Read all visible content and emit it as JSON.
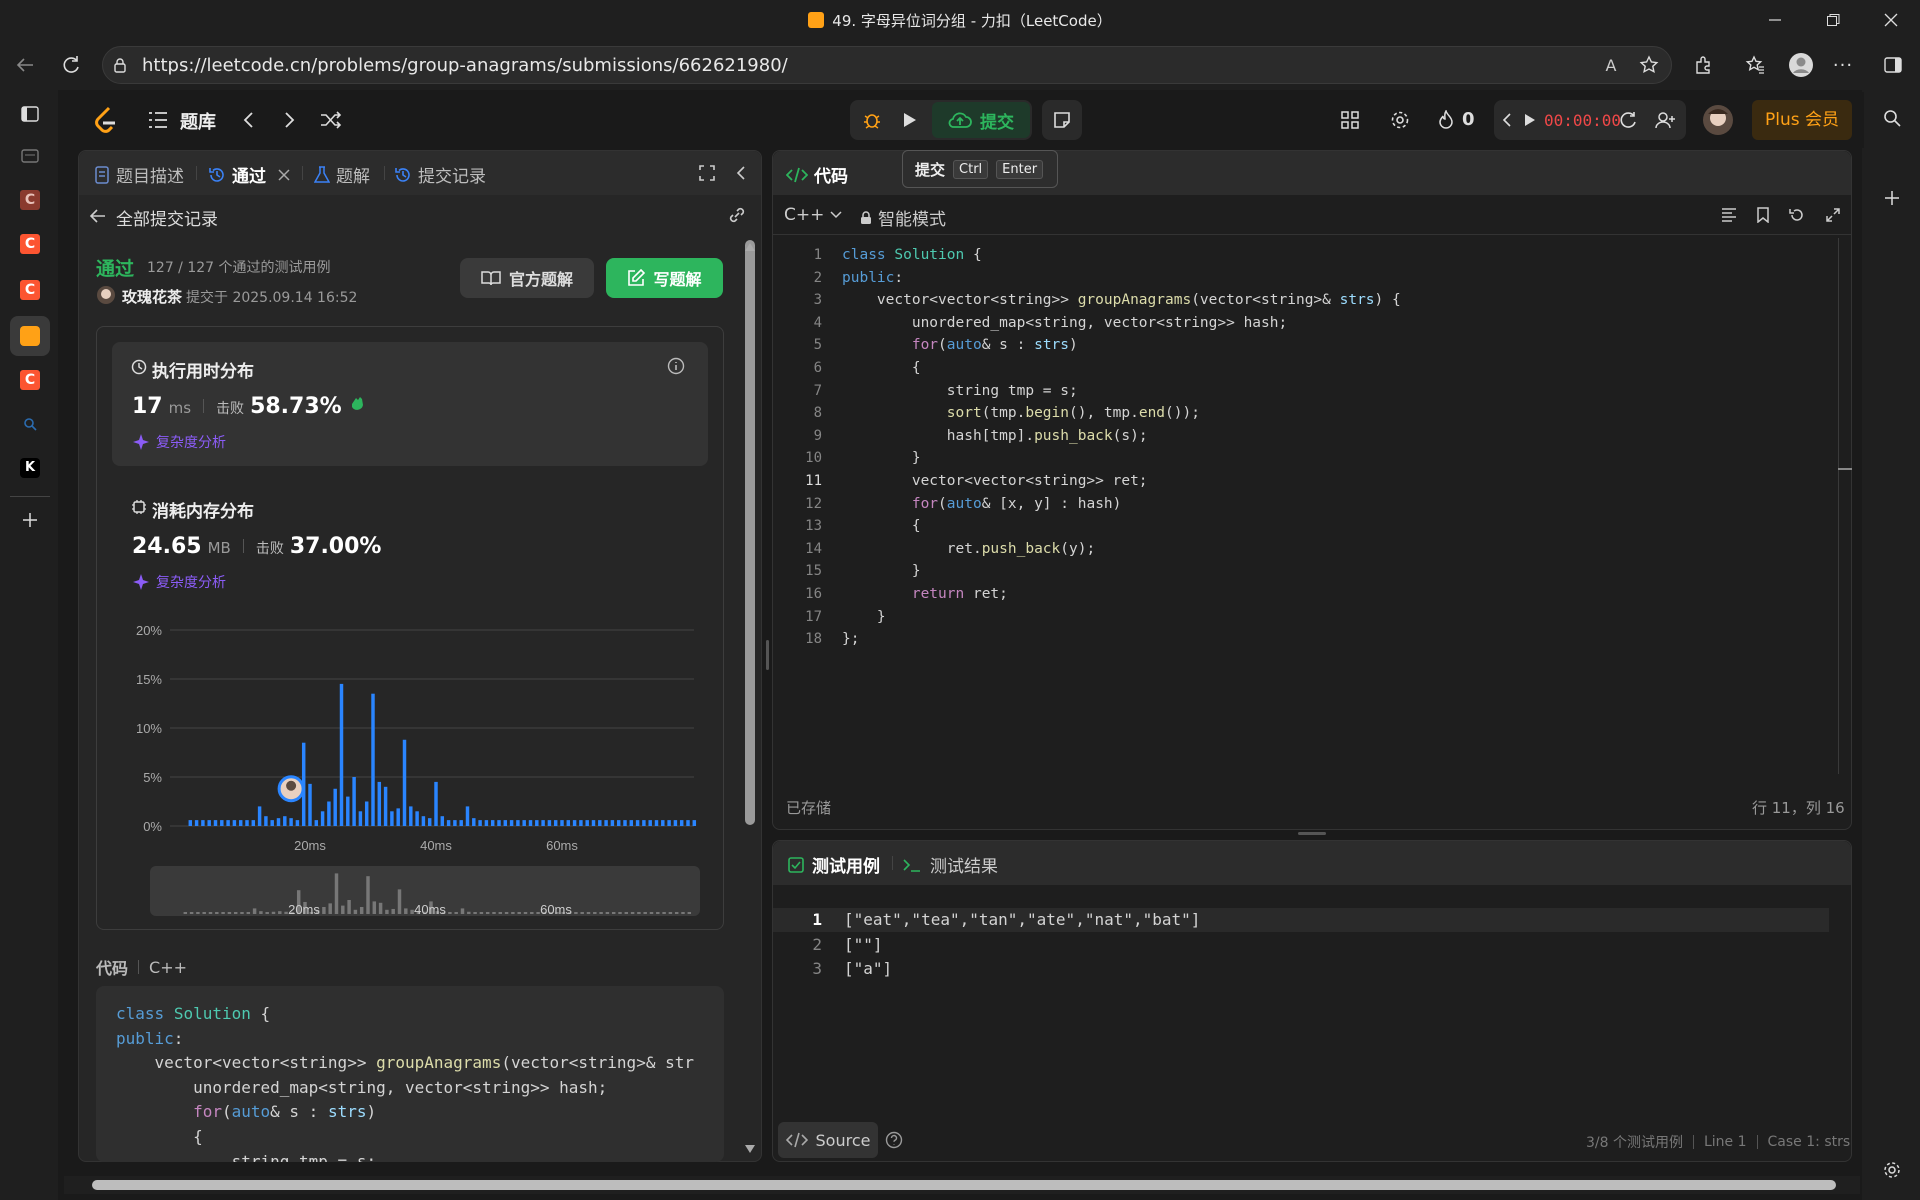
{
  "browser": {
    "title": "49. 字母异位词分组 - 力扣（LeetCode）",
    "url": "https://leetcode.cn/problems/group-anagrams/submissions/662621980/"
  },
  "nav": {
    "problem_bank": "题库",
    "submit": "提交",
    "streak": "0",
    "timer": "00:00:00",
    "plus": "Plus 会员",
    "tooltip": {
      "label": "提交",
      "key1": "Ctrl",
      "key2": "Enter"
    }
  },
  "left": {
    "tabs": [
      "题目描述",
      "通过",
      "题解",
      "提交记录"
    ],
    "back": "全部提交记录",
    "status": "通过",
    "testcases": "127 / 127 个通过的测试用例",
    "user": "玫瑰花茶",
    "submitted": "提交于 2025.09.14 16:52",
    "btn_official": "官方题解",
    "btn_write": "写题解",
    "runtime": {
      "title": "执行用时分布",
      "value": "17",
      "unit": "ms",
      "beat_label": "击败",
      "beat": "58.73%",
      "analysis": "复杂度分析"
    },
    "memory": {
      "title": "消耗内存分布",
      "value": "24.65",
      "unit": "MB",
      "beat_label": "击败",
      "beat": "37.00%",
      "analysis": "复杂度分析"
    },
    "code_label": "代码",
    "code_lang": "C++"
  },
  "chart_data": {
    "type": "bar",
    "title": "执行用时分布",
    "xlabel": "",
    "ylabel": "",
    "ylim": [
      0,
      20
    ],
    "y_ticks": [
      "0%",
      "5%",
      "10%",
      "15%",
      "20%"
    ],
    "x_ticks": [
      "20ms",
      "40ms",
      "60ms"
    ],
    "x_tick_values": [
      20,
      40,
      60
    ],
    "xlim": [
      0,
      80
    ],
    "bin_start": 1,
    "bin_width": 1,
    "values": [
      0.6,
      0.6,
      0.6,
      0.6,
      0.6,
      0.6,
      0.6,
      0.6,
      0.6,
      0.6,
      0.6,
      2.0,
      1.0,
      0.6,
      0.8,
      1.0,
      0.8,
      0.6,
      8.5,
      4.3,
      0.6,
      1.5,
      2.5,
      3.8,
      14.5,
      3.0,
      5.0,
      1.5,
      2.5,
      13.5,
      4.5,
      4.0,
      1.5,
      1.8,
      8.8,
      2.0,
      1.5,
      1.0,
      0.8,
      4.5,
      1.0,
      0.6,
      0.6,
      0.6,
      2.0,
      0.8,
      0.6,
      0.6,
      0.6,
      0.6,
      0.6,
      0.6,
      0.6,
      0.6,
      0.6,
      0.6,
      0.6,
      0.6,
      0.6,
      0.6,
      0.6,
      0.6,
      0.6,
      0.6,
      0.6,
      0.6,
      0.6,
      0.6,
      0.6,
      0.6,
      0.6,
      0.6,
      0.6,
      0.6,
      0.6,
      0.6,
      0.6,
      0.6,
      0.6,
      0.6,
      0.6
    ],
    "highlight_x": 17,
    "grid": true,
    "legend": "none"
  },
  "editor": {
    "title": "代码",
    "lang": "C++",
    "mode": "智能模式",
    "saved": "已存储",
    "cursor": "行 11，列 16",
    "line_numbers": [
      "1",
      "2",
      "3",
      "4",
      "5",
      "6",
      "7",
      "8",
      "9",
      "10",
      "11",
      "12",
      "13",
      "14",
      "15",
      "16",
      "17",
      "18"
    ]
  },
  "left_code_lines": [
    "class Solution {",
    "public:",
    "    vector<vector<string>> groupAnagrams(vector<string>& str",
    "        unordered_map<string, vector<string>> hash;",
    "        for(auto& s : strs)",
    "        {",
    "            string tmp = s;"
  ],
  "testcase": {
    "tab1": "测试用例",
    "tab2": "测试结果",
    "lines": [
      "[\"eat\",\"tea\",\"tan\",\"ate\",\"nat\",\"bat\"]",
      "[\"\"]",
      "[\"a\"]"
    ],
    "line_nums": [
      "1",
      "2",
      "3"
    ],
    "source": "Source",
    "status": "3/8 个测试用例",
    "line": "Line 1",
    "case": "Case 1: strs"
  }
}
